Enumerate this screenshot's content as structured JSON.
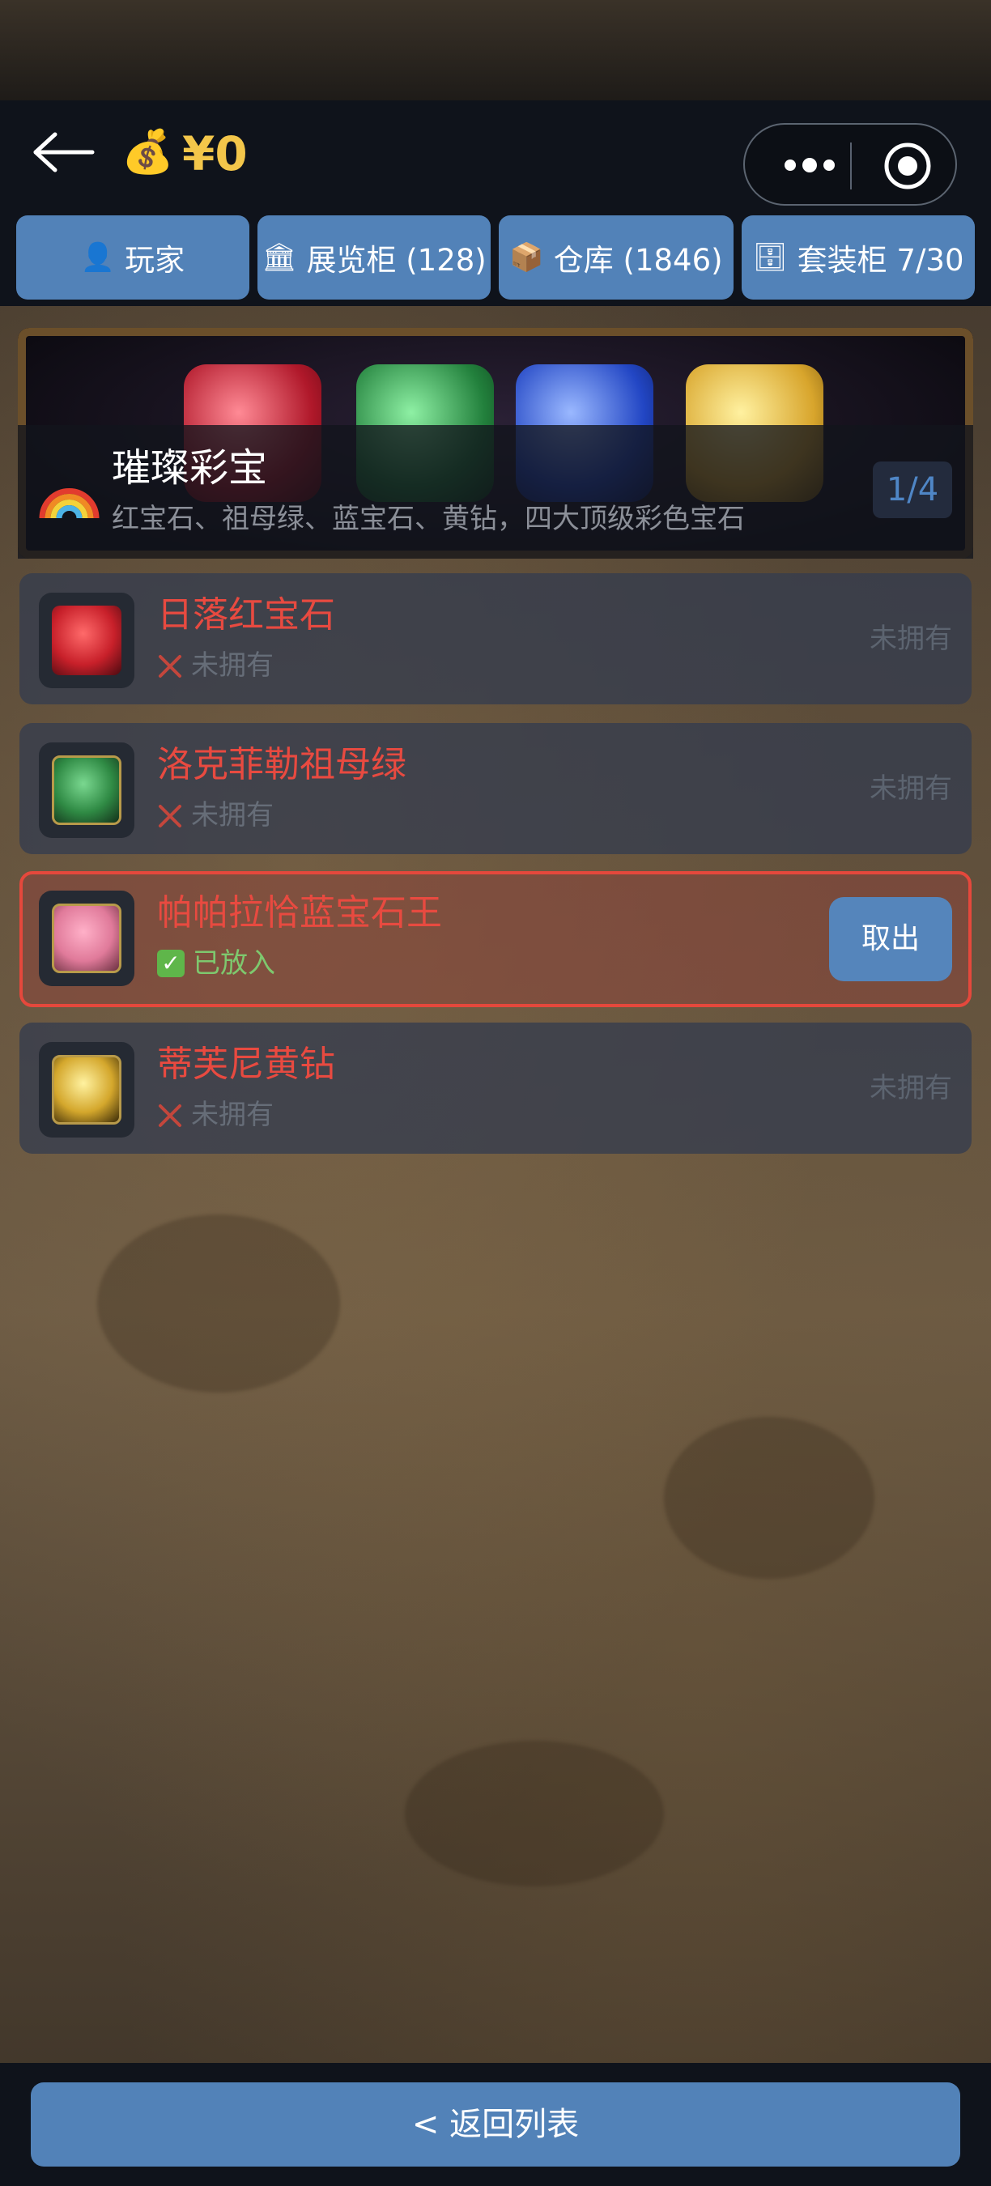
{
  "header": {
    "money": "¥0",
    "money_icon": "money-bag-icon",
    "back_icon": "back-arrow-icon",
    "menu_icon": "more-dots-icon",
    "close_icon": "target-circle-icon"
  },
  "tabs": [
    {
      "icon": "👤",
      "label": "玩家"
    },
    {
      "icon": "🏛",
      "label": "展览柜 (128)"
    },
    {
      "icon": "📦",
      "label": "仓库 (1846)"
    },
    {
      "icon": "🗄",
      "label": "套装柜 7/30"
    }
  ],
  "set": {
    "title": "璀璨彩宝",
    "description": "红宝石、祖母绿、蓝宝石、黄钻，四大顶级彩色宝石",
    "count": "1/4"
  },
  "items": [
    {
      "name": "日落红宝石",
      "status": "未拥有",
      "right": "未拥有",
      "state": "missing",
      "gem_color": "#c8202a"
    },
    {
      "name": "洛克菲勒祖母绿",
      "status": "未拥有",
      "right": "未拥有",
      "state": "missing",
      "gem_color": "#2f8a44"
    },
    {
      "name": "帕帕拉恰蓝宝石王",
      "status": "已放入",
      "right": "取出",
      "state": "placed",
      "gem_color": "#e07a9a"
    },
    {
      "name": "蒂芙尼黄钻",
      "status": "未拥有",
      "right": "未拥有",
      "state": "missing",
      "gem_color": "#d4a72c"
    }
  ],
  "footer": {
    "return_label": "< 返回列表"
  },
  "colors": {
    "accent": "#5282b8",
    "danger": "#e84a40",
    "gold": "#f3c64a",
    "ok": "#7ec86e"
  }
}
